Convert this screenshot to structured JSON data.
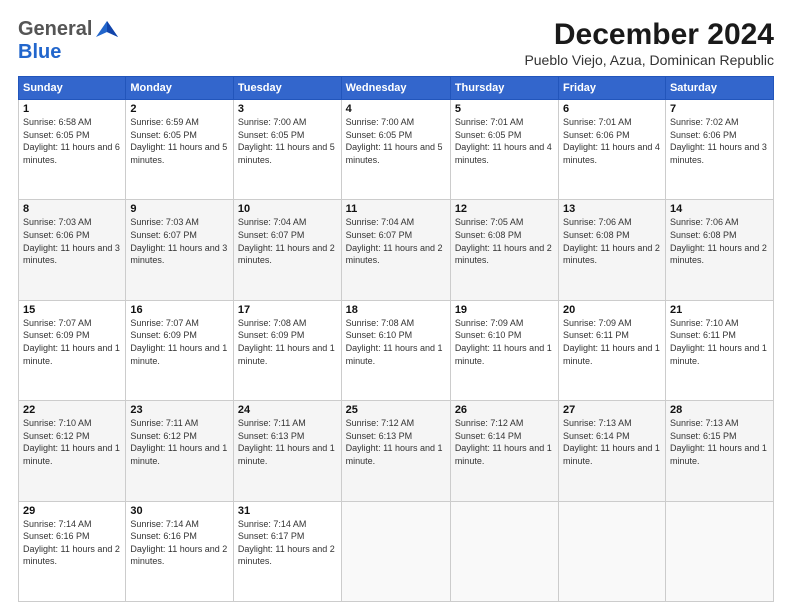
{
  "header": {
    "logo_general": "General",
    "logo_blue": "Blue",
    "title": "December 2024",
    "subtitle": "Pueblo Viejo, Azua, Dominican Republic"
  },
  "days_of_week": [
    "Sunday",
    "Monday",
    "Tuesday",
    "Wednesday",
    "Thursday",
    "Friday",
    "Saturday"
  ],
  "weeks": [
    [
      {
        "day": 1,
        "info": "Sunrise: 6:58 AM\nSunset: 6:05 PM\nDaylight: 11 hours and 6 minutes."
      },
      {
        "day": 2,
        "info": "Sunrise: 6:59 AM\nSunset: 6:05 PM\nDaylight: 11 hours and 5 minutes."
      },
      {
        "day": 3,
        "info": "Sunrise: 7:00 AM\nSunset: 6:05 PM\nDaylight: 11 hours and 5 minutes."
      },
      {
        "day": 4,
        "info": "Sunrise: 7:00 AM\nSunset: 6:05 PM\nDaylight: 11 hours and 5 minutes."
      },
      {
        "day": 5,
        "info": "Sunrise: 7:01 AM\nSunset: 6:05 PM\nDaylight: 11 hours and 4 minutes."
      },
      {
        "day": 6,
        "info": "Sunrise: 7:01 AM\nSunset: 6:06 PM\nDaylight: 11 hours and 4 minutes."
      },
      {
        "day": 7,
        "info": "Sunrise: 7:02 AM\nSunset: 6:06 PM\nDaylight: 11 hours and 3 minutes."
      }
    ],
    [
      {
        "day": 8,
        "info": "Sunrise: 7:03 AM\nSunset: 6:06 PM\nDaylight: 11 hours and 3 minutes."
      },
      {
        "day": 9,
        "info": "Sunrise: 7:03 AM\nSunset: 6:07 PM\nDaylight: 11 hours and 3 minutes."
      },
      {
        "day": 10,
        "info": "Sunrise: 7:04 AM\nSunset: 6:07 PM\nDaylight: 11 hours and 2 minutes."
      },
      {
        "day": 11,
        "info": "Sunrise: 7:04 AM\nSunset: 6:07 PM\nDaylight: 11 hours and 2 minutes."
      },
      {
        "day": 12,
        "info": "Sunrise: 7:05 AM\nSunset: 6:08 PM\nDaylight: 11 hours and 2 minutes."
      },
      {
        "day": 13,
        "info": "Sunrise: 7:06 AM\nSunset: 6:08 PM\nDaylight: 11 hours and 2 minutes."
      },
      {
        "day": 14,
        "info": "Sunrise: 7:06 AM\nSunset: 6:08 PM\nDaylight: 11 hours and 2 minutes."
      }
    ],
    [
      {
        "day": 15,
        "info": "Sunrise: 7:07 AM\nSunset: 6:09 PM\nDaylight: 11 hours and 1 minute."
      },
      {
        "day": 16,
        "info": "Sunrise: 7:07 AM\nSunset: 6:09 PM\nDaylight: 11 hours and 1 minute."
      },
      {
        "day": 17,
        "info": "Sunrise: 7:08 AM\nSunset: 6:09 PM\nDaylight: 11 hours and 1 minute."
      },
      {
        "day": 18,
        "info": "Sunrise: 7:08 AM\nSunset: 6:10 PM\nDaylight: 11 hours and 1 minute."
      },
      {
        "day": 19,
        "info": "Sunrise: 7:09 AM\nSunset: 6:10 PM\nDaylight: 11 hours and 1 minute."
      },
      {
        "day": 20,
        "info": "Sunrise: 7:09 AM\nSunset: 6:11 PM\nDaylight: 11 hours and 1 minute."
      },
      {
        "day": 21,
        "info": "Sunrise: 7:10 AM\nSunset: 6:11 PM\nDaylight: 11 hours and 1 minute."
      }
    ],
    [
      {
        "day": 22,
        "info": "Sunrise: 7:10 AM\nSunset: 6:12 PM\nDaylight: 11 hours and 1 minute."
      },
      {
        "day": 23,
        "info": "Sunrise: 7:11 AM\nSunset: 6:12 PM\nDaylight: 11 hours and 1 minute."
      },
      {
        "day": 24,
        "info": "Sunrise: 7:11 AM\nSunset: 6:13 PM\nDaylight: 11 hours and 1 minute."
      },
      {
        "day": 25,
        "info": "Sunrise: 7:12 AM\nSunset: 6:13 PM\nDaylight: 11 hours and 1 minute."
      },
      {
        "day": 26,
        "info": "Sunrise: 7:12 AM\nSunset: 6:14 PM\nDaylight: 11 hours and 1 minute."
      },
      {
        "day": 27,
        "info": "Sunrise: 7:13 AM\nSunset: 6:14 PM\nDaylight: 11 hours and 1 minute."
      },
      {
        "day": 28,
        "info": "Sunrise: 7:13 AM\nSunset: 6:15 PM\nDaylight: 11 hours and 1 minute."
      }
    ],
    [
      {
        "day": 29,
        "info": "Sunrise: 7:14 AM\nSunset: 6:16 PM\nDaylight: 11 hours and 2 minutes."
      },
      {
        "day": 30,
        "info": "Sunrise: 7:14 AM\nSunset: 6:16 PM\nDaylight: 11 hours and 2 minutes."
      },
      {
        "day": 31,
        "info": "Sunrise: 7:14 AM\nSunset: 6:17 PM\nDaylight: 11 hours and 2 minutes."
      },
      null,
      null,
      null,
      null
    ]
  ]
}
